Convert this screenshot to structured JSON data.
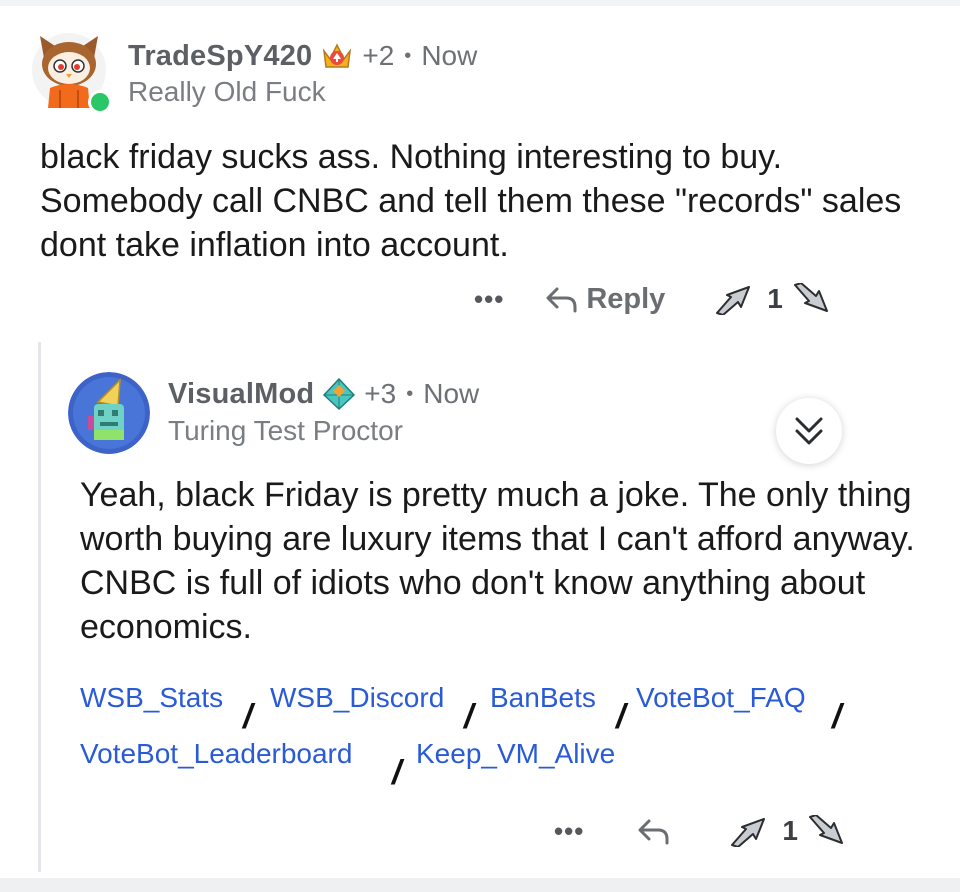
{
  "comment1": {
    "username": "TradeSpY420",
    "award_icon": "golden-crown-award-icon",
    "plus_count": "+2",
    "time": "Now",
    "flair": "Really Old Fuck",
    "body": "black friday sucks ass. Nothing interesting to buy. Somebody call CNBC and tell them these \"records\" sales dont take inflation into account.",
    "actions": {
      "more": "•••",
      "reply": "Reply",
      "votes": "1"
    },
    "online_color": "#2ac769"
  },
  "comment2": {
    "username": "VisualMod",
    "award_icon": "diamond-pyramid-award-icon",
    "plus_count": "+3",
    "time": "Now",
    "flair": "Turing Test Proctor",
    "body": "Yeah, black Friday is pretty much a joke. The only thing worth buying are luxury items that I can't afford anyway. CNBC is full of idiots who don't know anything about economics.",
    "links": [
      "WSB_Stats",
      "WSB_Discord",
      "BanBets",
      "VoteBot_FAQ",
      "VoteBot_Leaderboard",
      "Keep_VM_Alive"
    ],
    "separator": "/",
    "actions": {
      "more": "•••",
      "votes": "1"
    }
  },
  "colors": {
    "link": "#2a5bd7",
    "meta_text": "#6d7075",
    "thread_line": "#e4e6e9"
  }
}
